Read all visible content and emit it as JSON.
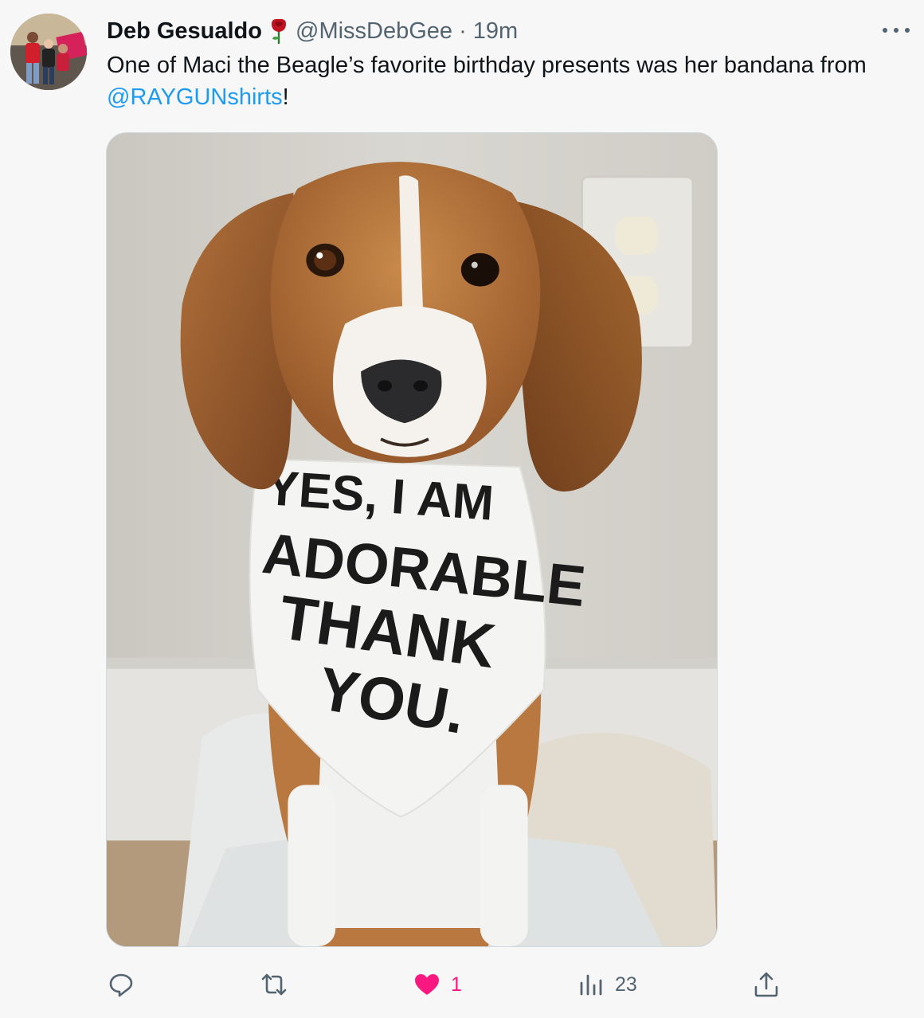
{
  "tweet": {
    "display_name": "Deb Gesualdo",
    "name_emoji": "rose-icon",
    "handle": "@MissDebGee",
    "separator": "·",
    "timestamp": "19m",
    "text_before": "One of Maci the Beagle’s favorite birthday presents was her bandana from ",
    "mention": "@RAYGUNshirts",
    "text_after": "!"
  },
  "media": {
    "bandana_lines": [
      "YES, I AM",
      "ADORABLE",
      "THANK",
      "YOU."
    ]
  },
  "actions": {
    "reply": {
      "icon": "reply-icon",
      "count": ""
    },
    "retweet": {
      "icon": "retweet-icon",
      "count": ""
    },
    "like": {
      "icon": "heart-icon",
      "count": "1",
      "liked": true,
      "color": "#f91880"
    },
    "views": {
      "icon": "views-icon",
      "count": "23"
    },
    "share": {
      "icon": "share-icon"
    }
  },
  "colors": {
    "link": "#1d9bf0",
    "secondary_text": "#536471",
    "like": "#f91880"
  }
}
